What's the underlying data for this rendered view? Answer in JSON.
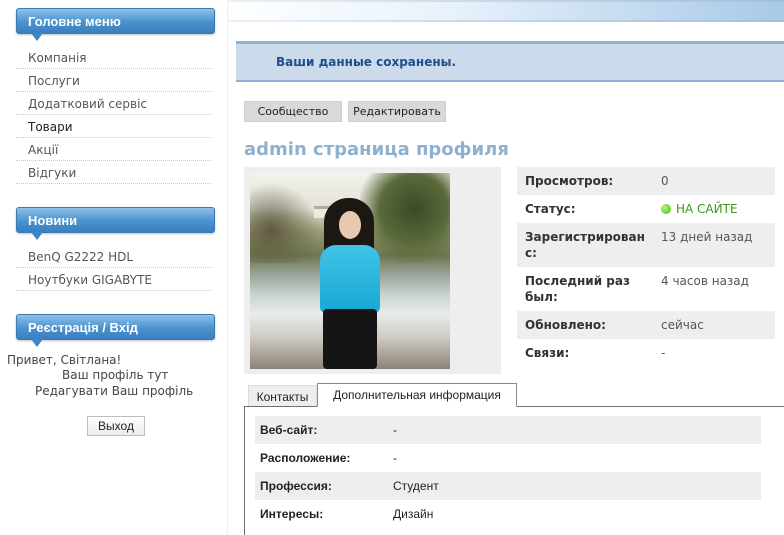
{
  "sidebar": {
    "main_menu": {
      "title": "Головне меню",
      "items": [
        {
          "label": "Компанія"
        },
        {
          "label": "Послуги"
        },
        {
          "label": "Додатковий сервіс"
        },
        {
          "label": "Товари"
        },
        {
          "label": "Акції"
        },
        {
          "label": "Відгуки"
        }
      ]
    },
    "news": {
      "title": "Новини",
      "items": [
        {
          "label": "BenQ G2222 HDL"
        },
        {
          "label": "Ноутбуки GIGABYTE"
        }
      ]
    },
    "login": {
      "title": "Реєстрація / Вхід",
      "greeting": "Привет, Світлана!",
      "profile_link": "Ваш профіль тут",
      "edit_link": "Редагувати Ваш профіль",
      "logout_label": "Выход"
    }
  },
  "main": {
    "message": "Ваши данные сохранены.",
    "buttons": {
      "community": "Сообщество",
      "edit": "Редактировать"
    },
    "page_title": "admin страница профиля",
    "stats": [
      {
        "label": "Просмотров:",
        "value": "0"
      },
      {
        "label": "Статус:",
        "value": "НА САЙТЕ"
      },
      {
        "label": "Зарегистрирован с:",
        "value": "13 дней назад"
      },
      {
        "label": "Последний раз был:",
        "value": "4 часов назад"
      },
      {
        "label": "Обновлено:",
        "value": "сейчас"
      },
      {
        "label": "Связи:",
        "value": "-"
      }
    ],
    "tabs": [
      {
        "label": "Контакты"
      },
      {
        "label": "Дополнительная информация"
      }
    ],
    "active_tab": "Дополнительная информация",
    "info_rows": [
      {
        "label": "Веб-сайт:",
        "value": "-"
      },
      {
        "label": "Расположение:",
        "value": "-"
      },
      {
        "label": "Профессия:",
        "value": "Студент"
      },
      {
        "label": "Интересы:",
        "value": "Дизайн"
      }
    ]
  },
  "colors": {
    "header_blue": "#4a92cf",
    "message_bg": "#cbdbec",
    "message_text": "#1f4e8c",
    "title_color": "#8fb1d0",
    "online_green": "#43b51b"
  },
  "icons": {
    "status": "online-dot-icon"
  }
}
